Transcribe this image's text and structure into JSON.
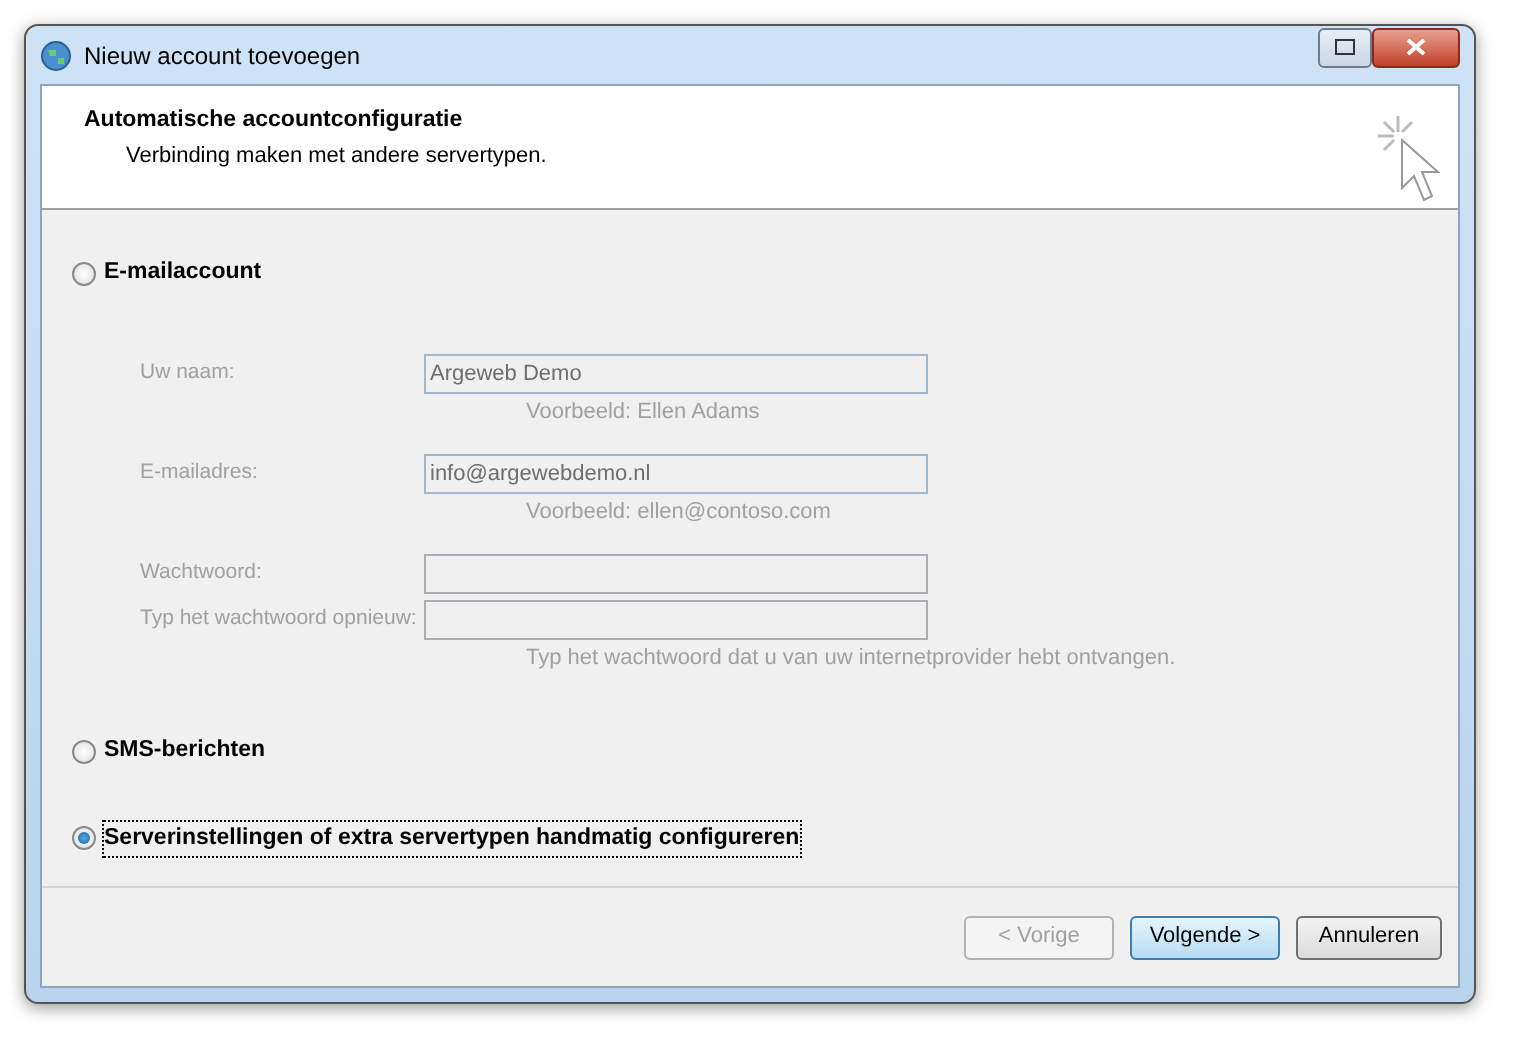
{
  "window": {
    "title": "Nieuw account toevoegen"
  },
  "header": {
    "title": "Automatische accountconfiguratie",
    "subtitle": "Verbinding maken met andere servertypen."
  },
  "options": [
    {
      "label": "E-mailaccount",
      "selected": false,
      "fields": [
        {
          "label": "Uw naam:",
          "value": "Argeweb Demo",
          "hint": "Voorbeeld: Ellen Adams",
          "disabled": true
        },
        {
          "label": "E-mailadres:",
          "value": "info@argewebdemo.nl",
          "hint": "Voorbeeld: ellen@contoso.com",
          "disabled": true
        },
        {
          "label": "Wachtwoord:",
          "disabled": true
        },
        {
          "label": "Typ het wachtwoord opnieuw:",
          "hint": "Typ het wachtwoord dat u van uw internetprovider hebt ontvangen.",
          "disabled": true
        }
      ]
    },
    {
      "label": "SMS-berichten",
      "selected": false
    },
    {
      "label": "Serverinstellingen of extra servertypen handmatig configureren",
      "selected": true
    }
  ],
  "buttons": [
    {
      "label": "< Vorige",
      "disabled": true,
      "default": false
    },
    {
      "label": "Volgende >",
      "disabled": false,
      "default": true
    },
    {
      "label": "Annuleren",
      "disabled": false,
      "default": false
    }
  ]
}
